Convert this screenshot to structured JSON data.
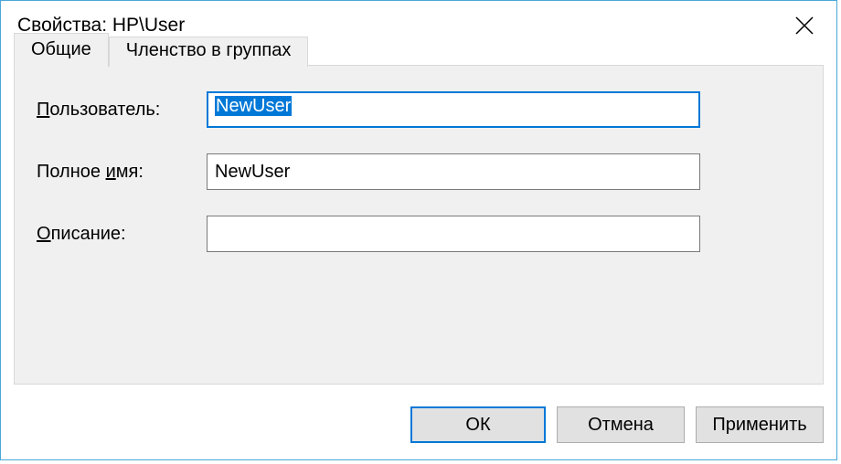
{
  "window": {
    "title": "Свойства: HP\\User"
  },
  "tabs": {
    "general": "Общие",
    "membership": "Членство в группах"
  },
  "form": {
    "user_label_prefix": "П",
    "user_label_rest": "ользователь:",
    "user_value": "NewUser",
    "fullname_label_prefix": "Полное ",
    "fullname_label_u": "и",
    "fullname_label_rest": "мя:",
    "fullname_value": "NewUser",
    "description_label_u": "О",
    "description_label_rest": "писание:",
    "description_value": ""
  },
  "buttons": {
    "ok": "ОК",
    "cancel": "Отмена",
    "apply": "Применить"
  }
}
